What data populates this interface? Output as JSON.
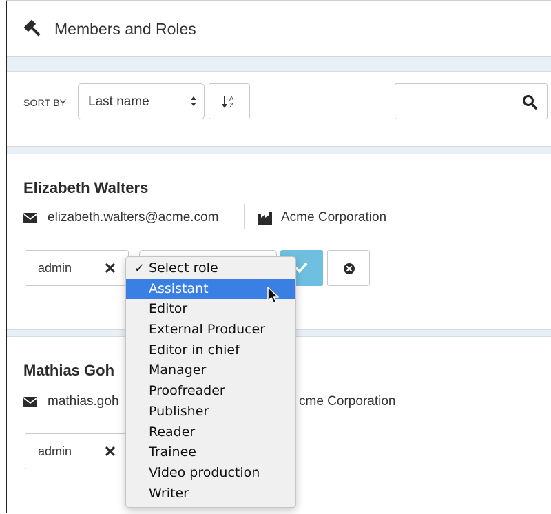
{
  "header": {
    "title": "Members and Roles",
    "icon": "gavel-icon"
  },
  "sortbar": {
    "label": "SORT BY",
    "selected": "Last name",
    "direction_icon": "sort-alpha-asc-icon",
    "search_value": "",
    "search_icon": "search-icon"
  },
  "members": [
    {
      "name": "Elizabeth Walters",
      "email": "elizabeth.walters@acme.com",
      "company": "Acme Corporation",
      "role": "admin"
    },
    {
      "name": "Mathias Goh",
      "email": "mathias.goh",
      "company": "cme Corporation",
      "role": "admin"
    }
  ],
  "role_menu": {
    "checked": "Select role",
    "highlighted": "Assistant",
    "options": [
      "Select role",
      "Assistant",
      "Editor",
      "External Producer",
      "Editor in chief",
      "Manager",
      "Proofreader",
      "Publisher",
      "Reader",
      "Trainee",
      "Video production",
      "Writer"
    ]
  },
  "colors": {
    "confirm": "#6fc0e0",
    "highlight": "#3a7fe3",
    "band": "#e9f0f5"
  }
}
